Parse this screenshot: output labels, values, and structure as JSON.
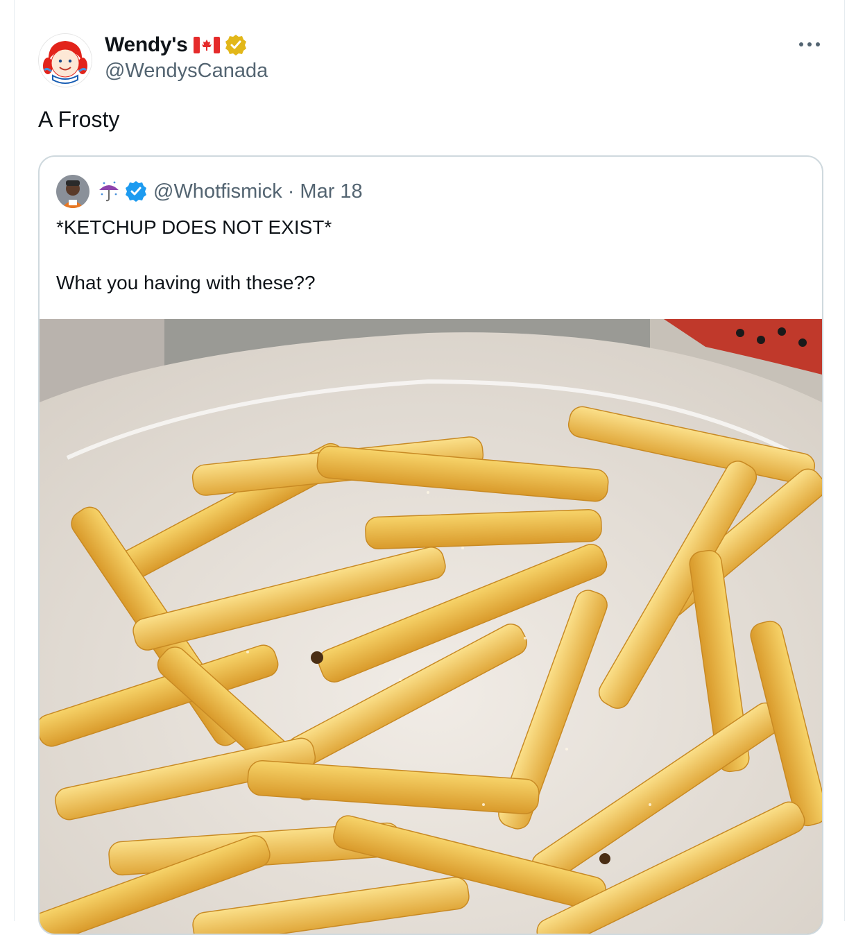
{
  "post": {
    "author": {
      "display_name": "Wendy's",
      "flag_icon": "canada-flag-icon",
      "verified_badge": "gold-verified-icon",
      "handle": "@WendysCanada"
    },
    "more_icon": "ellipsis-icon",
    "text": "A Frosty",
    "quoted": {
      "handle": "@Whotfismick",
      "separator": "·",
      "date": "Mar 18",
      "emoji_icon": "umbrella-rain-icon",
      "verified_badge": "blue-verified-icon",
      "line1": "*KETCHUP DOES NOT EXIST*",
      "line2": "What you having with these??",
      "photo": "french-fries-photo"
    }
  },
  "colors": {
    "text": "#0f1419",
    "secondary": "#536471",
    "border": "#cfd9de",
    "verified_blue": "#1d9bf0",
    "verified_gold": "#e2b719"
  }
}
